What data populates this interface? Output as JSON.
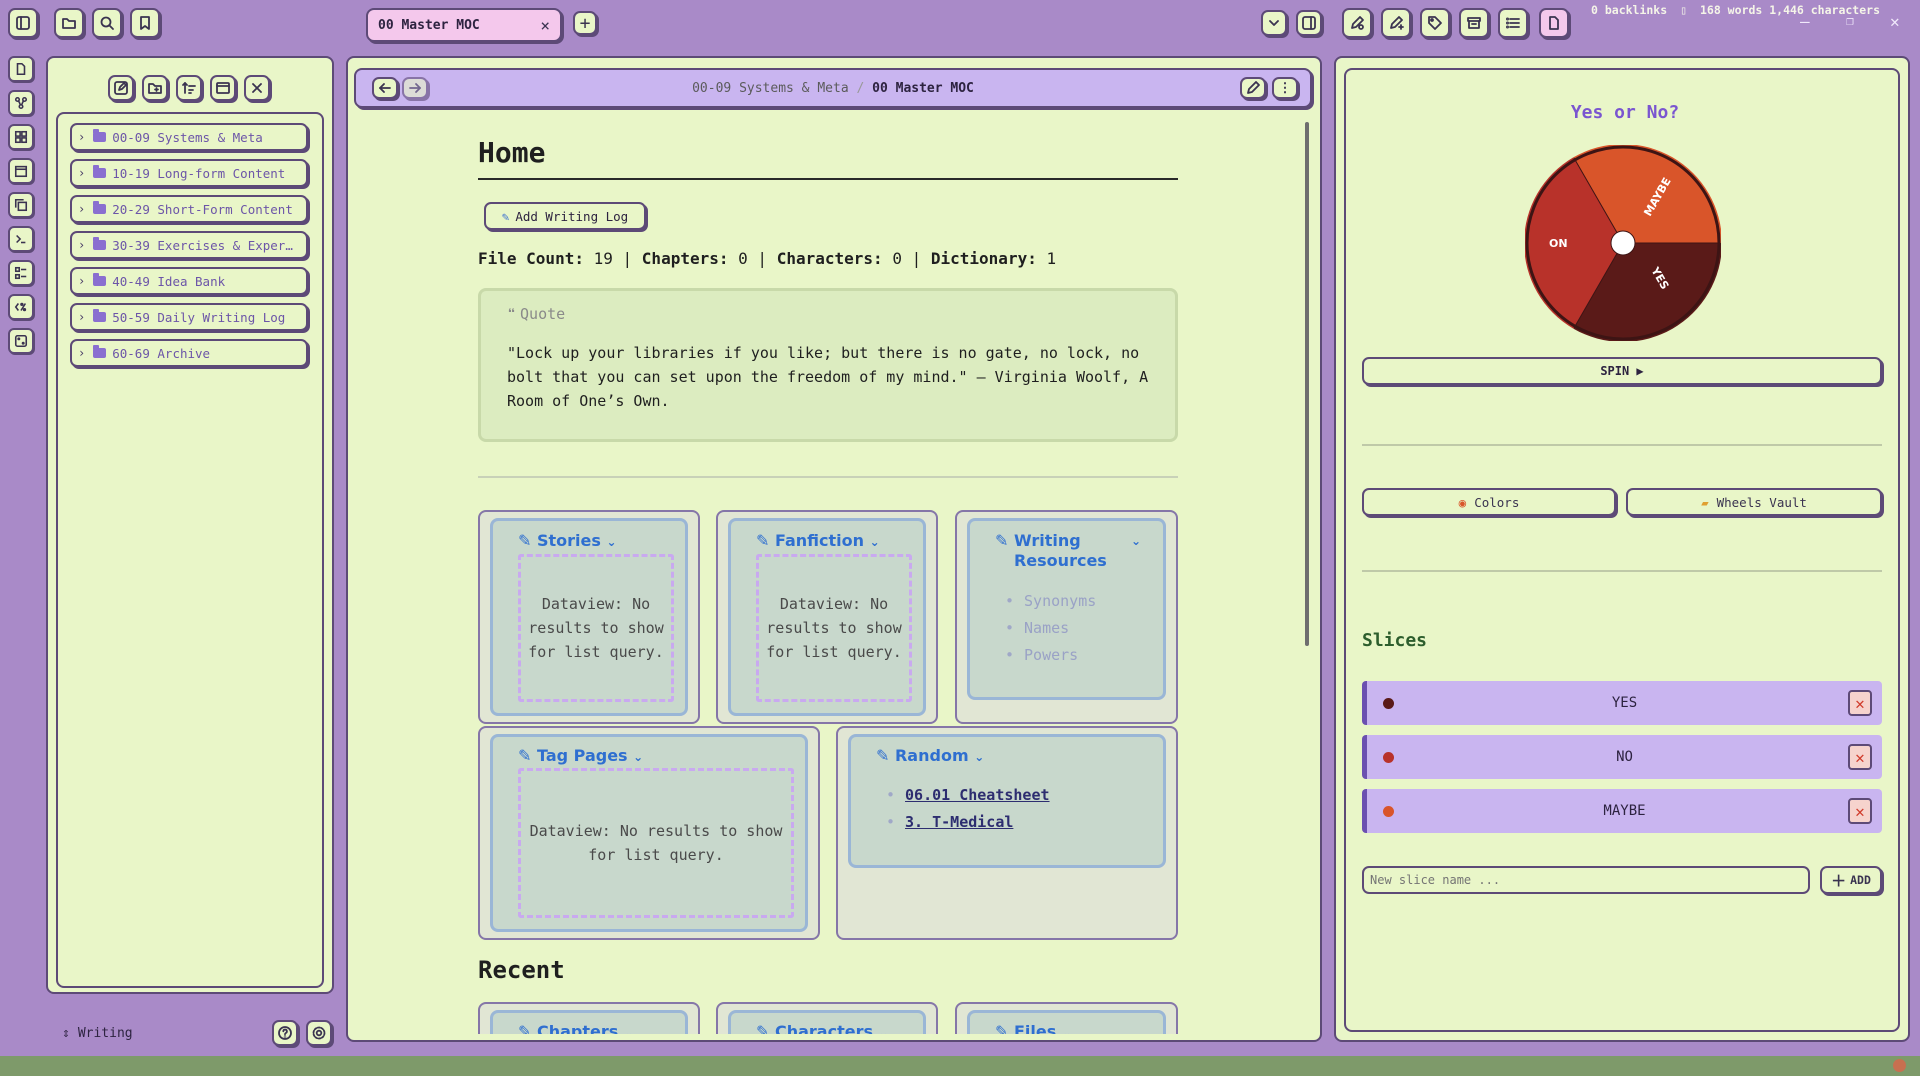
{
  "window": {
    "tab_title": "00 Master MOC",
    "tab_close": "×",
    "new_tab": "+",
    "minimize": "—",
    "maximize": "❐",
    "close": "✕"
  },
  "sidebar": {
    "folders": [
      {
        "label": "00-09 Systems & Meta"
      },
      {
        "label": "10-19 Long-form Content"
      },
      {
        "label": "20-29 Short-Form Content"
      },
      {
        "label": "30-39 Exercises & Exper…"
      },
      {
        "label": "40-49 Idea Bank"
      },
      {
        "label": "50-59 Daily Writing Log"
      },
      {
        "label": "60-69 Archive"
      }
    ],
    "vault_name": "Writing"
  },
  "note": {
    "breadcrumb_parent": "00-09 Systems & Meta",
    "breadcrumb_sep": "/",
    "breadcrumb_current": "00 Master MOC",
    "title": "Home",
    "add_log_label": "Add Writing Log",
    "stats": {
      "file_count_label": "File Count:",
      "file_count": "19",
      "chapters_label": "Chapters:",
      "chapters": "0",
      "characters_label": "Characters:",
      "characters": "0",
      "dictionary_label": "Dictionary:",
      "dictionary": "1",
      "sep": "|"
    },
    "quote_header": "Quote",
    "quote_text": "\"Lock up your libraries if you like; but there is no gate, no lock, no bolt that you can set upon the freedom of my mind.\" — Virginia Woolf, A Room of One’s Own.",
    "cards": {
      "stories": {
        "title": "Stories",
        "empty": "Dataview: No results to show for list query."
      },
      "fanfiction": {
        "title": "Fanfiction",
        "empty": "Dataview: No results to show for list query."
      },
      "writing_resources": {
        "title": "Writing Resources",
        "items": [
          "Synonyms",
          "Names",
          "Powers"
        ]
      },
      "tag_pages": {
        "title": "Tag Pages",
        "empty": "Dataview: No results to show for list query."
      },
      "random": {
        "title": "Random",
        "links": [
          "06.01 Cheatsheet",
          "3. T-Medical"
        ]
      }
    },
    "recent_heading": "Recent",
    "recent_cards": [
      "Chapters",
      "Characters",
      "Files"
    ]
  },
  "wheel": {
    "title": "Yes or No?",
    "spin_label": "SPIN ▶",
    "colors_label": "Colors",
    "vault_label": "Wheels Vault",
    "slices_heading": "Slices",
    "slices": [
      {
        "label": "YES",
        "color": "#5a1a18"
      },
      {
        "label": "NO",
        "color": "#b8322a"
      },
      {
        "label": "MAYBE",
        "color": "#d9552a"
      }
    ],
    "wheel_labels": {
      "on": "ON",
      "maybe": "MAYBE",
      "yes": "YES"
    },
    "new_slice_placeholder": "New slice name ...",
    "add_label": "ADD"
  },
  "status": {
    "text": "0 backlinks",
    "words": "168 words 1,446 characters"
  },
  "colors": {
    "background": "#a98ac8",
    "panel": "#e9f6c8",
    "accent": "#7a55d0",
    "link": "#2f6fd0",
    "statusbar": "#7e9a6a"
  }
}
